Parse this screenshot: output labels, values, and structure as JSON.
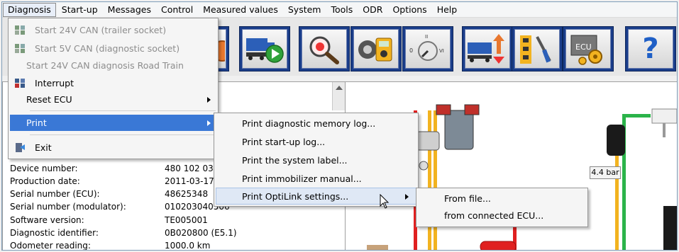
{
  "menubar": {
    "items": [
      "Diagnosis",
      "Start-up",
      "Messages",
      "Control",
      "Measured values",
      "System",
      "Tools",
      "ODR",
      "Options",
      "Help"
    ]
  },
  "diagnosis_menu": {
    "start_24v": "Start 24V CAN (trailer socket)",
    "start_5v": "Start 5V CAN (diagnostic socket)",
    "start_24v_road_train": "Start 24V CAN diagnosis Road Train",
    "interrupt": "Interrupt",
    "reset_ecu": "Reset ECU",
    "print": "Print",
    "exit": "Exit"
  },
  "print_submenu": {
    "items": [
      "Print diagnostic memory log...",
      "Print start-up log...",
      "Print the system label...",
      "Print immobilizer manual...",
      "Print OptiLink settings..."
    ]
  },
  "optilink_submenu": {
    "items": [
      "From file...",
      "from connected ECU..."
    ]
  },
  "device_info": {
    "rows": [
      {
        "label": "Device number:",
        "value": "480 102 031"
      },
      {
        "label": "Production date:",
        "value": "2011-03-17"
      },
      {
        "label": "Serial number (ECU):",
        "value": "48625348"
      },
      {
        "label": "Serial number (modulator):",
        "value": "010203040506"
      },
      {
        "label": "Software version:",
        "value": "TE005001"
      },
      {
        "label": "Diagnostic identifier:",
        "value": "0B020800 (E5.1)"
      },
      {
        "label": "Odometer reading:",
        "value": "1000.0 km"
      }
    ]
  },
  "diagram": {
    "pressure_label": "4.4 bar"
  },
  "toolbar": {
    "icons": [
      "orange-circle-icon",
      "truck-play-icon",
      "magnifier-icon",
      "multimeter-icon",
      "gauge-dial-icon",
      "truck-updown-icon",
      "axle-tools-icon",
      "ecu-gear-icon",
      "help-icon"
    ],
    "help_glyph": "?"
  },
  "colors": {
    "toolbar_frame": "#1a3d8a",
    "menu_highlight": "#3a78d6",
    "pipe_red": "#e02020",
    "pipe_green": "#2bb34a",
    "pipe_yellow": "#f2b320"
  }
}
